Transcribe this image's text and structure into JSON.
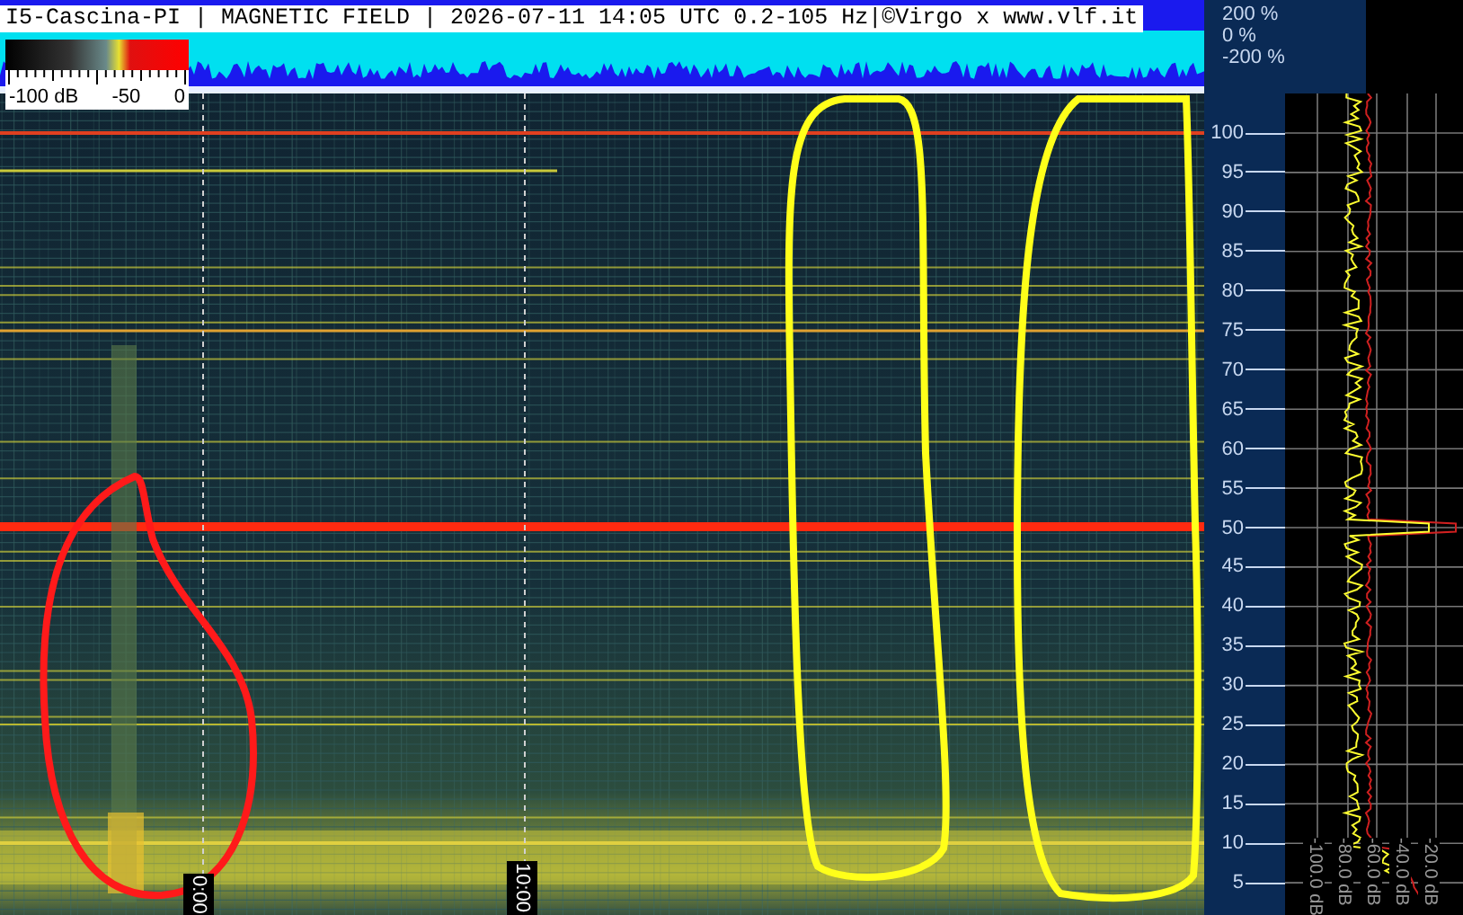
{
  "header": {
    "title": "I5-Cascina-PI | MAGNETIC FIELD | 2026-07-11 14:05 UTC 0.2-105 Hz|©Virgo x www.vlf.it"
  },
  "waveform_scale": [
    "200 %",
    "0 %",
    "-200 %"
  ],
  "color_scale": {
    "labels": [
      "-100 dB",
      "-50",
      "0"
    ]
  },
  "time_markers": [
    "0:00",
    "10:00"
  ],
  "frequency_axis": [
    "100",
    "95",
    "90",
    "85",
    "80",
    "75",
    "70",
    "65",
    "60",
    "55",
    "50",
    "45",
    "40",
    "35",
    "30",
    "25",
    "20",
    "15",
    "10",
    "5"
  ],
  "spectrum_axis": [
    "-100.0 dB",
    "-80.0 dB",
    "-60.0 dB",
    "-40.0 dB",
    "-20.0 dB"
  ],
  "annotations": [
    {
      "kind": "outline",
      "color": "#ff1a1a"
    },
    {
      "kind": "outline",
      "color": "#ffff1a"
    },
    {
      "kind": "outline",
      "color": "#ffff1a"
    }
  ]
}
